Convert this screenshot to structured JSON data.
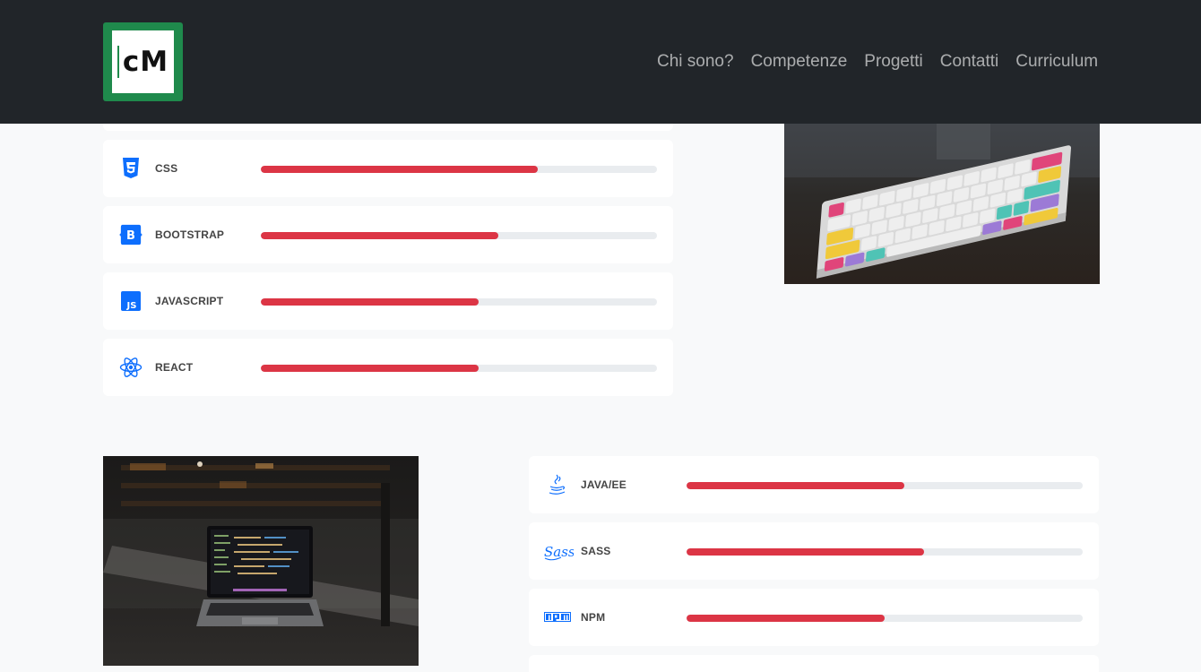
{
  "header": {
    "logo_text": "cM",
    "nav": [
      "Chi sono?",
      "Competenze",
      "Progetti",
      "Contatti",
      "Curriculum"
    ]
  },
  "colors": {
    "nav_bg": "#212529",
    "logo_green": "#1f8a4c",
    "bar_fill": "#dc3545",
    "bar_track": "#e9ecef",
    "icon_blue": "#0d6efd"
  },
  "skills_left": [
    {
      "label": "CSS",
      "icon": "css3-icon",
      "level": 70
    },
    {
      "label": "BOOTSTRAP",
      "icon": "bootstrap-icon",
      "level": 60
    },
    {
      "label": "JAVASCRIPT",
      "icon": "javascript-icon",
      "level": 55
    },
    {
      "label": "REACT",
      "icon": "react-icon",
      "level": 55
    }
  ],
  "skills_right": [
    {
      "label": "JAVA/EE",
      "icon": "java-icon",
      "level": 55
    },
    {
      "label": "SASS",
      "icon": "sass-icon",
      "level": 60
    },
    {
      "label": "NPM",
      "icon": "npm-icon",
      "level": 50
    }
  ]
}
